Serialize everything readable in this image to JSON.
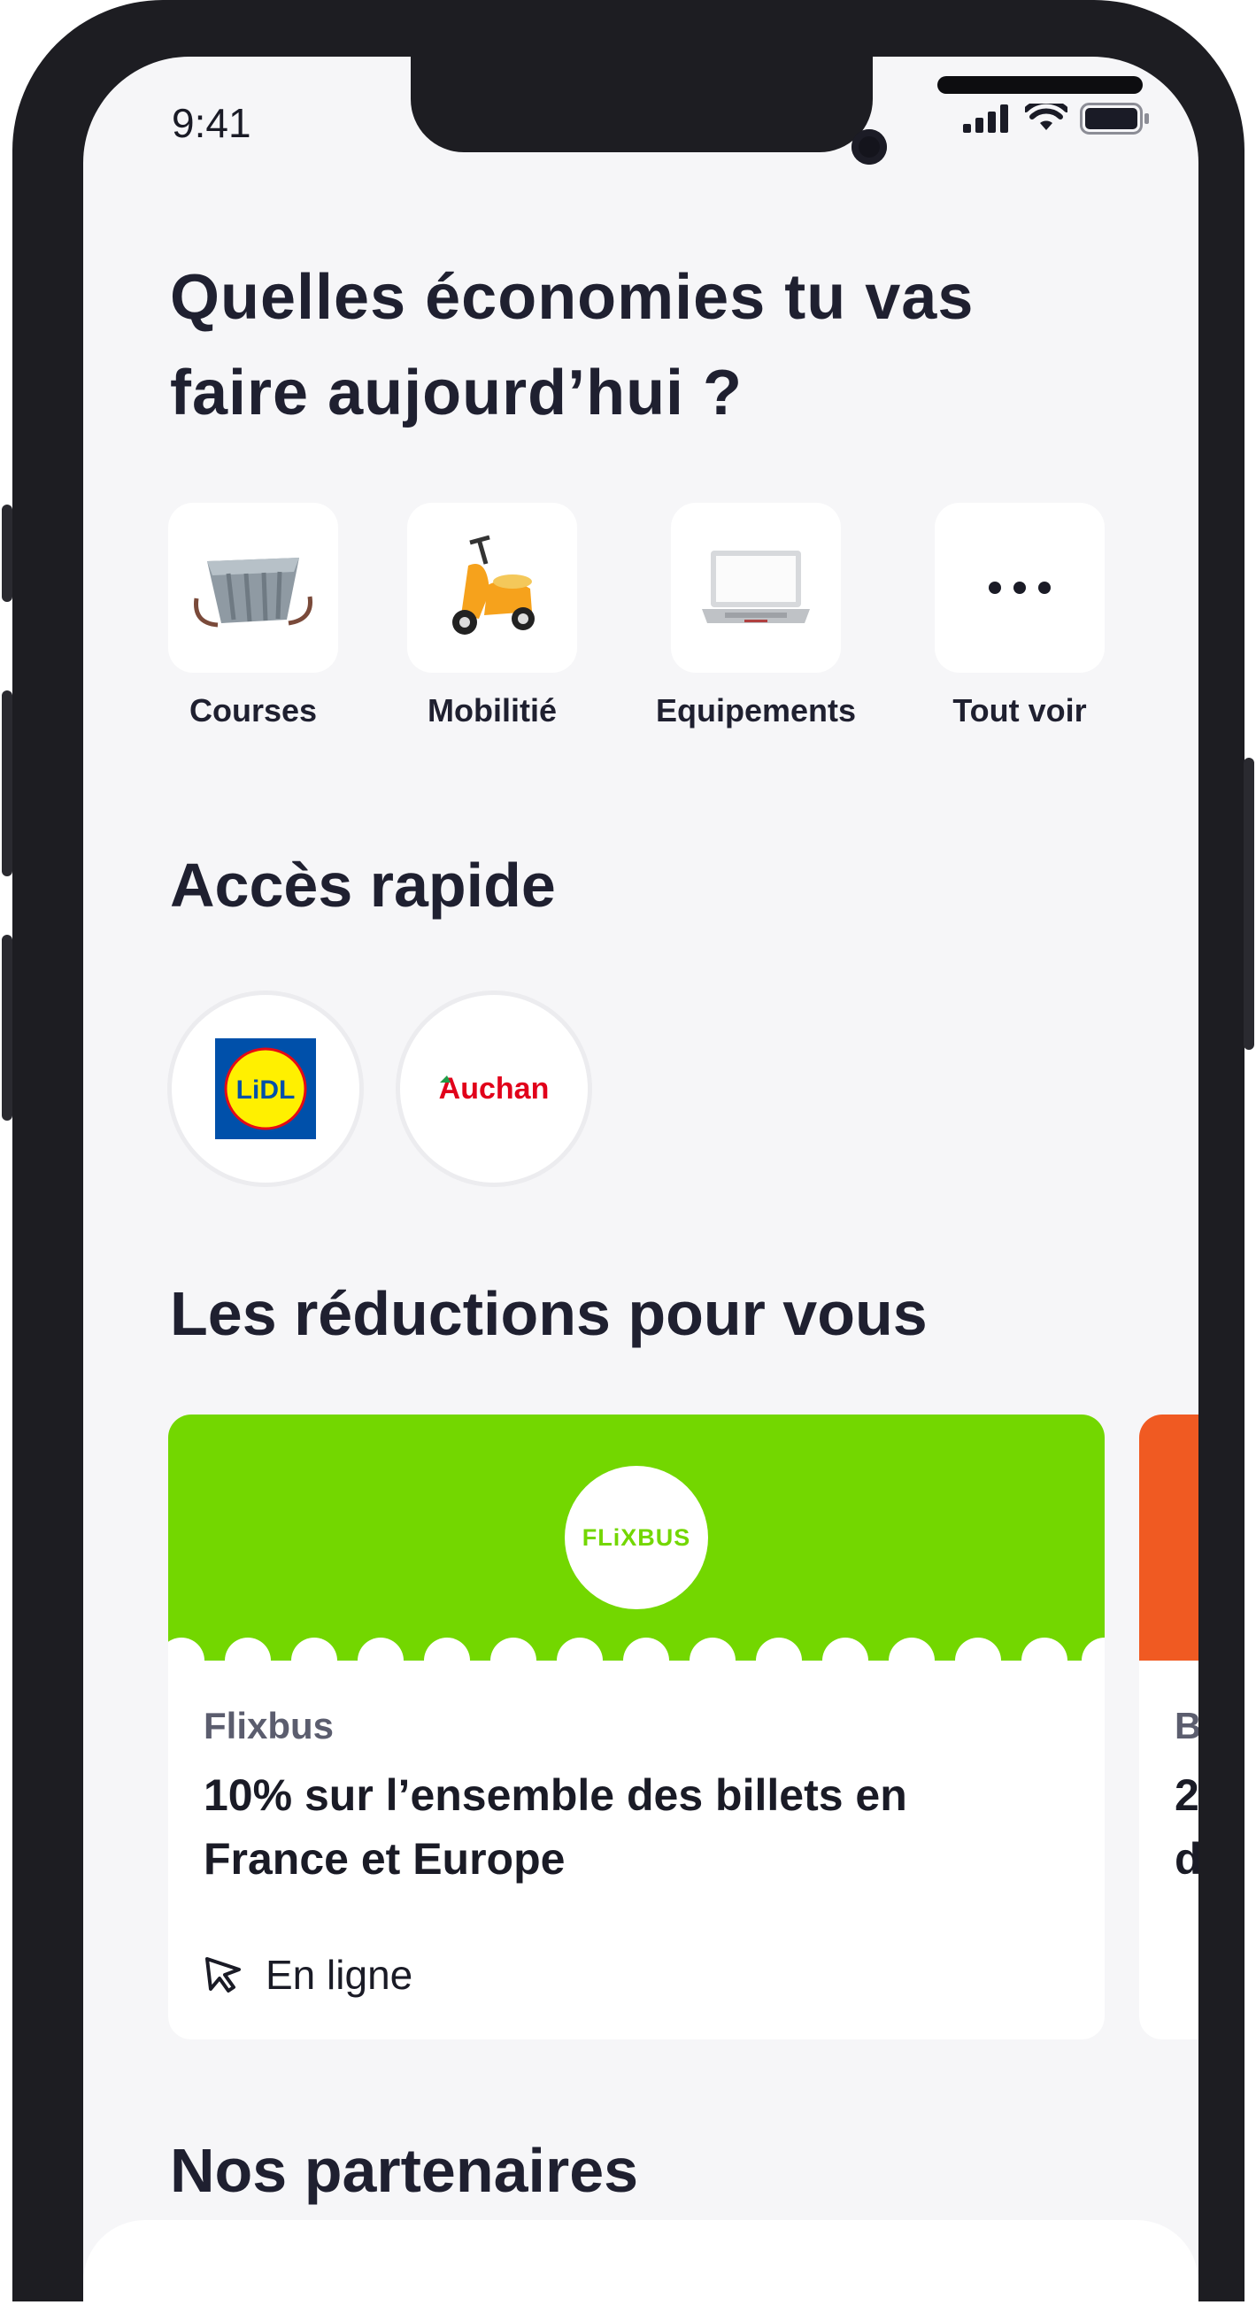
{
  "status_bar": {
    "time": "9:41"
  },
  "header": {
    "title": "Quelles économies tu vas faire aujourd’hui ?"
  },
  "categories": [
    {
      "label": "Courses",
      "icon": "shopping-basket-icon"
    },
    {
      "label": "Mobilitié",
      "icon": "scooter-icon"
    },
    {
      "label": "Equipements",
      "icon": "laptop-icon"
    },
    {
      "label": "Tout voir",
      "icon": "more-dots-icon"
    }
  ],
  "quick_access": {
    "title": "Accès rapide",
    "stores": [
      {
        "name": "LIDL",
        "logo": "lidl-logo"
      },
      {
        "name": "Auchan",
        "logo": "auchan-logo"
      }
    ]
  },
  "reductions": {
    "title": "Les réductions pour vous",
    "cards": [
      {
        "logo_text": "FLiXBUS",
        "brand": "Flixbus",
        "description": "10% sur l’ensemble des billets en France et Europe",
        "channel": "En ligne",
        "banner_color": "#73d700"
      },
      {
        "brand": "B",
        "description": "2\nd",
        "banner_color": "#f05a22"
      }
    ]
  },
  "partners": {
    "title": "Nos partenaires"
  }
}
